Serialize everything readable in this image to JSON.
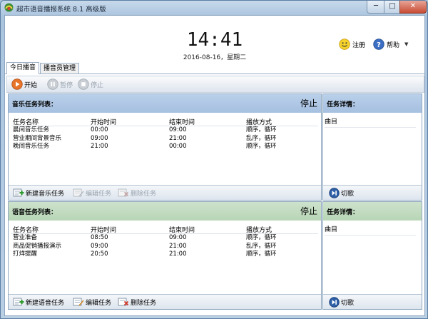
{
  "window": {
    "title": "超市语音播报系统 8.1 高级版",
    "min": "─",
    "max": "□",
    "close": "✕"
  },
  "clock": {
    "time": "14:41",
    "date": "2016-08-16，星期二"
  },
  "header": {
    "register_label": "注册",
    "help_label": "帮助",
    "menu_arrow": "▼"
  },
  "tabs": [
    {
      "label": "今日播音",
      "active": true
    },
    {
      "label": "播音员管理",
      "active": false
    }
  ],
  "toolbar": {
    "start": "开始",
    "pause": "暂停",
    "stop": "停止"
  },
  "music_panel": {
    "title": "音乐任务列表：",
    "status": "停止",
    "columns": [
      "任务名称",
      "开始时间",
      "结束时间",
      "播放方式"
    ],
    "rows": [
      [
        "晨间音乐任务",
        "00:00",
        "09:00",
        "顺序，循环"
      ],
      [
        "营业期间背景音乐",
        "09:00",
        "21:00",
        "乱序，循环"
      ],
      [
        "晚间音乐任务",
        "21:00",
        "00:00",
        "顺序，循环"
      ]
    ],
    "new_task": "新建音乐任务",
    "edit_task": "编辑任务",
    "delete_task": "删除任务"
  },
  "music_detail": {
    "title": "任务详情：",
    "column": "曲目",
    "switch_song": "切歌"
  },
  "voice_panel": {
    "title": "语音任务列表：",
    "status": "停止",
    "columns": [
      "任务名称",
      "开始时间",
      "结束时间",
      "播放方式"
    ],
    "rows": [
      [
        "营业准备",
        "08:50",
        "09:00",
        "顺序，循环"
      ],
      [
        "商品促销播报演示",
        "09:00",
        "21:00",
        "乱序，循环"
      ],
      [
        "打烊提醒",
        "20:50",
        "21:00",
        "顺序，循环"
      ]
    ],
    "new_task": "新建语音任务",
    "edit_task": "编辑任务",
    "delete_task": "删除任务"
  },
  "voice_detail": {
    "title": "任务详情：",
    "column": "曲目",
    "switch_song": "切歌"
  },
  "colors": {
    "music_header": "#b0c8e6",
    "voice_header": "#c2dbc0",
    "start_orange": "#e8742a"
  }
}
